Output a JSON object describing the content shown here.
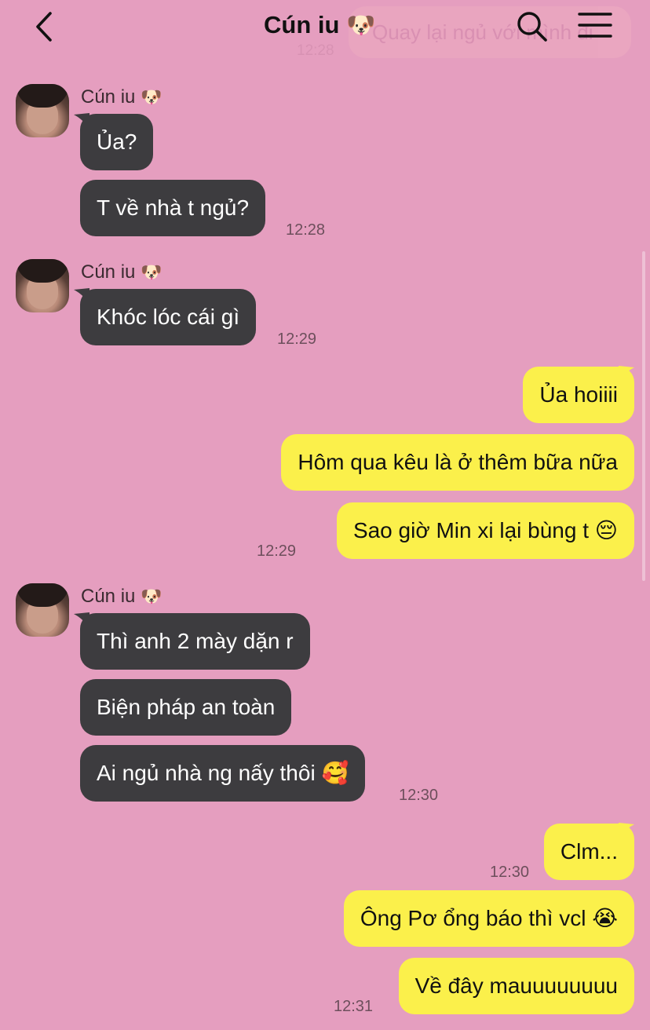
{
  "header": {
    "title": "Cún iu",
    "title_emoji": "🐶",
    "ghost_text": "Quay lại ngủ với mình đi",
    "ghost_time": "12:28"
  },
  "sender_name": "Cún iu",
  "sender_emoji": "🐶",
  "colors": {
    "background": "#e59ebf",
    "incoming_bubble": "#3d3c3f",
    "outgoing_bubble": "#fbf04b"
  },
  "icons": {
    "back": "chevron-left-icon",
    "search": "search-icon",
    "menu": "hamburger-menu-icon"
  },
  "messages": {
    "g1": {
      "m1": "Ủa?",
      "m2": "T về nhà t ngủ?",
      "time": "12:28"
    },
    "g2": {
      "m1": "Khóc lóc cái gì",
      "time": "12:29"
    },
    "g3": {
      "m1": "Ủa hoiiii",
      "m2": "Hôm qua kêu là ở thêm bữa nữa",
      "m3_text": "Sao giờ Min xi lại bùng t",
      "m3_emoji": "😔",
      "time": "12:29"
    },
    "g4": {
      "m1": "Thì anh 2 mày dặn r",
      "m2": "Biện pháp an toàn",
      "m3_text": "Ai ngủ nhà ng nấy thôi",
      "m3_emoji": "🥰",
      "time": "12:30"
    },
    "g5": {
      "m1": "Clm...",
      "time1": "12:30",
      "m2_text": "Ông Pơ ổng báo thì vcl",
      "m2_emoji": "😭",
      "m3": "Về đây mauuuuuuuu",
      "time2": "12:31"
    }
  }
}
